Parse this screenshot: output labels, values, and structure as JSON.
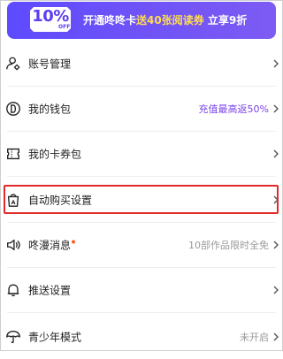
{
  "banner": {
    "badge": "10%",
    "badge_sub": "OFF",
    "text_prefix": "开通咚咚卡",
    "text_highlight": "送40张阅读券",
    "text_suffix": " 立享9折",
    "colors": {
      "background": "#5e4bff",
      "highlight": "#ffdd4d"
    }
  },
  "menu": {
    "items": [
      {
        "label": "账号管理",
        "value": "",
        "icon": "user-settings-icon"
      },
      {
        "label": "我的钱包",
        "value": "充值最高返50%",
        "icon": "coin-icon"
      },
      {
        "label": "我的卡券包",
        "value": "",
        "icon": "ticket-icon"
      },
      {
        "label": "自动购买设置",
        "value": "",
        "icon": "shopping-bag-icon"
      },
      {
        "label": "咚漫消息",
        "value": "10部作品限时全免",
        "icon": "speaker-icon"
      },
      {
        "label": "推送设置",
        "value": "",
        "icon": "bell-icon"
      },
      {
        "label": "青少年模式",
        "value": "未开启",
        "icon": "umbrella-icon"
      }
    ]
  },
  "colors": {
    "accent": "#7a43e8",
    "highlight_border": "#e32a2a",
    "notification_dot": "#ff5b2e"
  }
}
